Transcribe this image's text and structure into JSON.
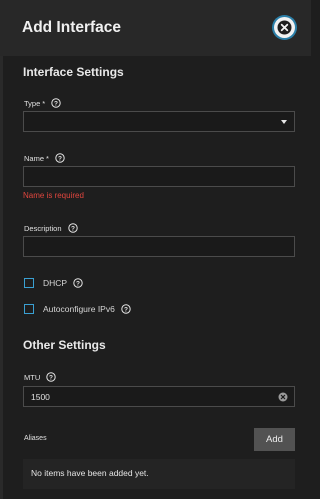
{
  "dialog": {
    "title": "Add Interface"
  },
  "interface_settings": {
    "title": "Interface Settings",
    "type": {
      "label": "Type",
      "required_mark": "*",
      "value": ""
    },
    "name": {
      "label": "Name",
      "required_mark": "*",
      "value": "",
      "error": "Name is required"
    },
    "description": {
      "label": "Description",
      "value": ""
    },
    "dhcp": {
      "label": "DHCP",
      "checked": false
    },
    "autoconfigure_ipv6": {
      "label": "Autoconfigure IPv6",
      "checked": false
    }
  },
  "other_settings": {
    "title": "Other Settings",
    "mtu": {
      "label": "MTU",
      "value": "1500"
    }
  },
  "aliases": {
    "label": "Aliases",
    "add_label": "Add",
    "empty_text": "No items have been added yet."
  },
  "colors": {
    "accent": "#3aa0d2",
    "error": "#e0463e",
    "background": "#1e1e1e"
  }
}
